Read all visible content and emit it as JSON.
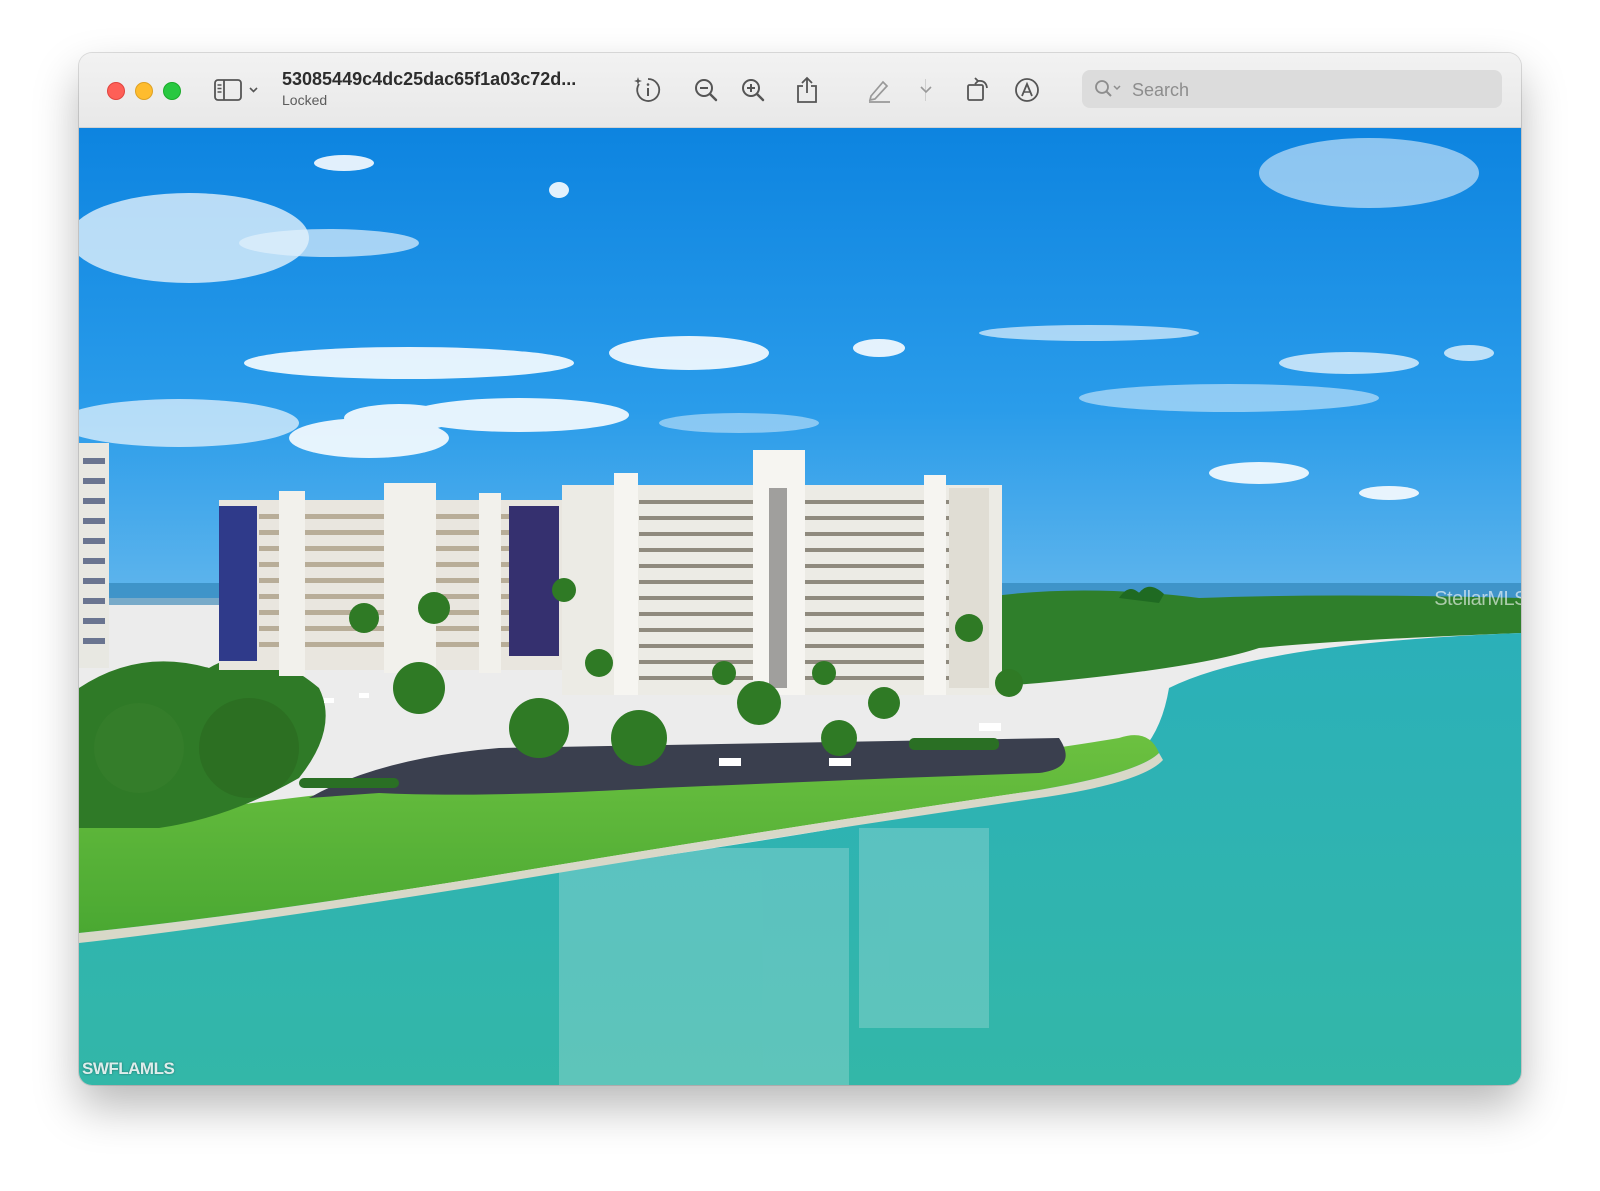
{
  "window": {
    "title": "53085449c4dc25dac65f1a03c72d...",
    "subtitle": "Locked"
  },
  "toolbar": {
    "sidebar_icon": "sidebar-toggle-icon",
    "info_icon": "info-icon",
    "zoom_out_icon": "zoom-out-icon",
    "zoom_in_icon": "zoom-in-icon",
    "share_icon": "share-icon",
    "markup_icon": "pen-icon",
    "rotate_icon": "rotate-icon",
    "annotate_icon": "markup-circle-icon"
  },
  "search": {
    "placeholder": "Search",
    "value": ""
  },
  "image": {
    "watermark_left": "SWFLAMLS",
    "watermark_right": "StellarMLS"
  },
  "colors": {
    "close": "#fe5f57",
    "minimize": "#febc2e",
    "maximize": "#28c840",
    "sky": "#1f93e6",
    "water": "#2fb3b8",
    "lawn": "#5cb83a"
  }
}
